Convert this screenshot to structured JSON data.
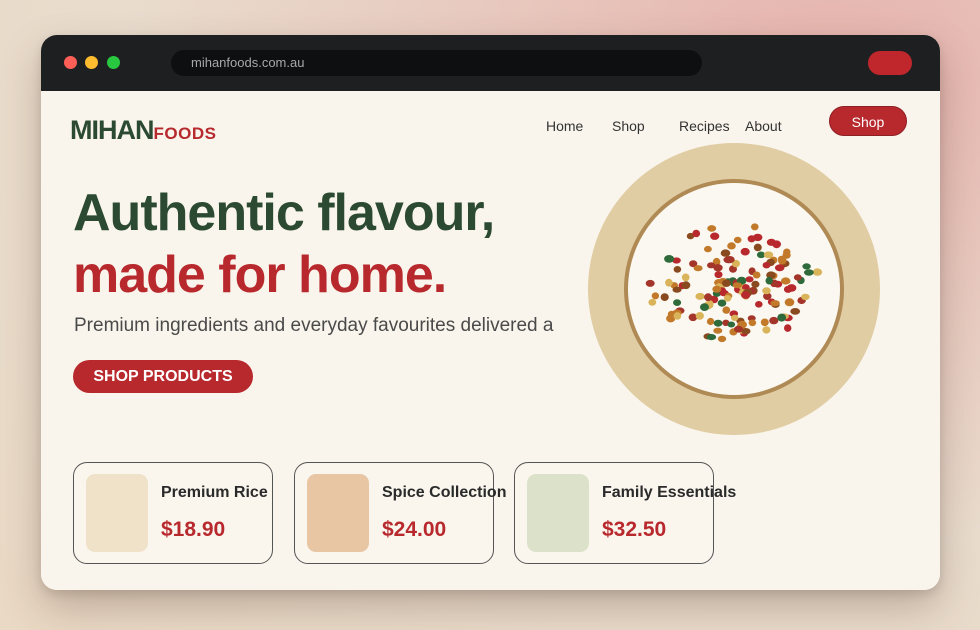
{
  "browser": {
    "url": "mihanfoods.com.au"
  },
  "brand": {
    "name_primary": "MIHAN",
    "name_secondary": "FOODS"
  },
  "nav": {
    "items": [
      "Home",
      "Shop",
      "Recipes",
      "About"
    ],
    "cta_label": "Shop"
  },
  "hero": {
    "headline_line1": "Authentic flavour,",
    "headline_line2": "made for home.",
    "subtitle": "Premium ingredients and everyday favourites delivered a",
    "button_label": "SHOP PRODUCTS"
  },
  "products": [
    {
      "name": "Premium Rice",
      "price": "$18.90",
      "thumb_color": "#efe2c8"
    },
    {
      "name": "Spice Collection",
      "price": "$24.00",
      "thumb_color": "#e8c6a4"
    },
    {
      "name": "Family Essentials",
      "price": "$32.50",
      "thumb_color": "#dce1c9"
    }
  ],
  "colors": {
    "brand_green": "#2c4a32",
    "brand_red": "#b8292e",
    "page_background": "#f9f5ec",
    "bowl_rim": "#e1cda3"
  },
  "icons": {
    "window_controls": [
      "close-dot",
      "minimize-dot",
      "maximize-dot"
    ],
    "hero_image": "spice-bowl"
  }
}
